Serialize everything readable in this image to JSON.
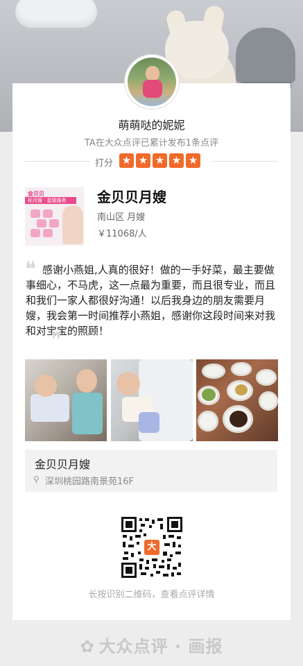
{
  "header": {
    "username": "萌萌哒的妮妮",
    "subtitle": "TA在大众点评已累计发布1条点评"
  },
  "rating": {
    "label": "打分",
    "stars": 5,
    "star_glyph": "★",
    "star_color": "#f06a2a"
  },
  "shop": {
    "name": "金贝贝月嫂",
    "area": "南山区 月嫂",
    "price": "￥11068/人",
    "image_icon": "shop-thumbnail",
    "image_logo": "金贝贝",
    "image_banner": "标月嫂 · 星级服务"
  },
  "review": {
    "text": "感谢小燕姐,人真的很好！做的一手好菜，最主要做事细心，不马虎，这一点最为重要，而且很专业，而且和我们一家人都很好沟通！以后我身边的朋友需要月嫂，我会第一时间推荐小燕姐，感谢你这段时间来对我和对宝宝的照顾！",
    "quote_open": "❝",
    "quote_close": "❞"
  },
  "photos": [
    "photo-baby-and-boy",
    "photo-caregiver-holding-baby",
    "photo-dinner-table"
  ],
  "address": {
    "title": "金贝贝月嫂",
    "pin_icon": "location-pin-icon",
    "pin_glyph": "⚲",
    "text": "深圳桃园路南景苑16F"
  },
  "qr": {
    "badge": "大",
    "caption": "长按识别二维码，查看点评详情"
  },
  "footer": {
    "brand": "大众点评 · 画报",
    "icon": "dianping-logo-icon",
    "icon_glyph": "✿"
  }
}
